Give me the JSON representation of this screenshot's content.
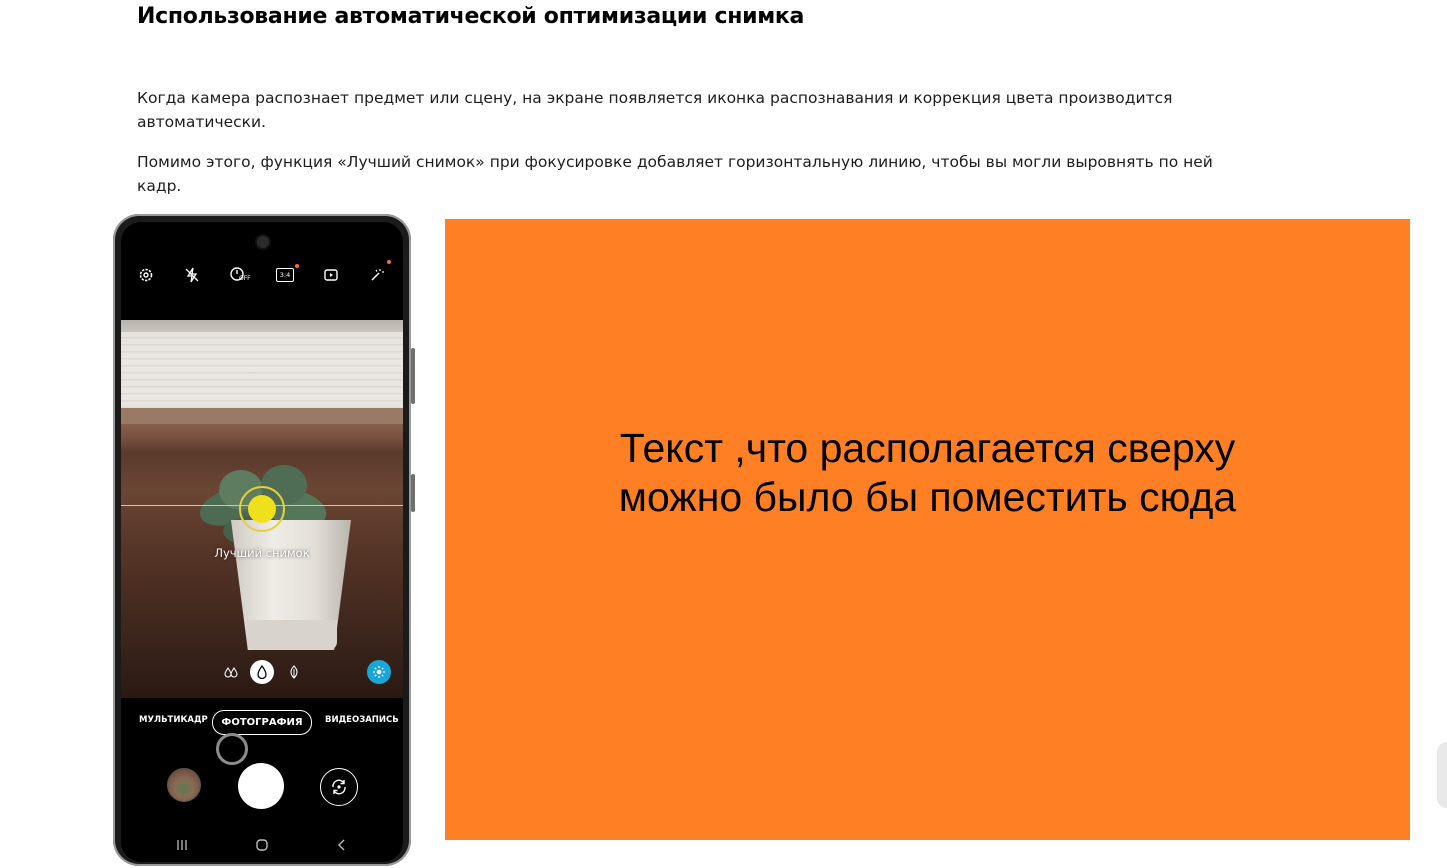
{
  "article": {
    "title": "Использование автоматической оптимизации снимка",
    "paragraphs": [
      "Когда камера распознает предмет или сцену, на экране появляется иконка распознавания и коррекция цвета производится автоматически.",
      "Помимо этого, функция «Лучший снимок» при фокусировке добавляет горизонтальную линию, чтобы вы могли выровнять по ней кадр."
    ]
  },
  "phone": {
    "top_icons": [
      "settings-icon",
      "flash-off-icon",
      "timer-off-icon",
      "ratio-3-4-icon",
      "motion-photo-icon",
      "effects-icon"
    ],
    "timer_label": "OFF",
    "ratio_label": "3:4",
    "best_shot_label": "Лучший снимок",
    "modes": {
      "left": "МУЛЬТИКАДР",
      "active": "ФОТОГРАФИЯ",
      "right": "ВИДЕОЗАПИСЬ"
    },
    "accent_colors": {
      "focus": "#f0e01b",
      "scene": "#1ba6d8",
      "notify_dot": "#ff6b2c"
    }
  },
  "panel": {
    "text_line1": "Текст ,что располагается сверху",
    "text_line2": "можно было бы поместить сюда",
    "background": "#ff8024"
  }
}
